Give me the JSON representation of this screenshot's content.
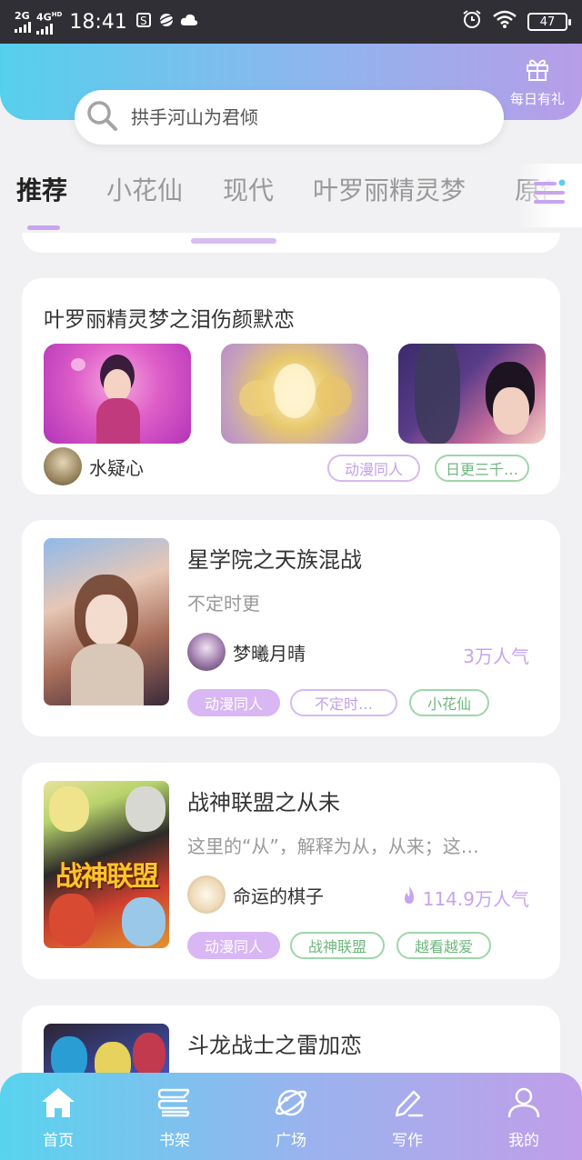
{
  "status_bar": {
    "net1": "2G",
    "net2": "4G",
    "net2_sup": "HD",
    "time": "18:41",
    "battery": "47"
  },
  "header": {
    "gift_label": "每日有礼",
    "search_placeholder": "拱手河山为君倾"
  },
  "tabs": [
    "推荐",
    "小花仙",
    "现代",
    "叶罗丽精灵梦",
    "原创"
  ],
  "collection": {
    "title": "叶罗丽精灵梦之泪伤颜默恋",
    "author": "水疑心",
    "tags": [
      "动漫同人",
      "日更三千…"
    ]
  },
  "books": [
    {
      "title": "星学院之天族混战",
      "desc": "不定时更",
      "author": "梦曦月晴",
      "popularity": "3万人气",
      "hot": false,
      "tags": [
        "动漫同人",
        "不定时…",
        "小花仙"
      ]
    },
    {
      "title": "战神联盟之从未",
      "desc": "这里的“从”，解释为从，从来；这…",
      "author": "命运的棋子",
      "popularity": "114.9万人气",
      "hot": true,
      "cover_text": "战神联盟",
      "tags": [
        "动漫同人",
        "战神联盟",
        "越看越爱"
      ]
    },
    {
      "title": "斗龙战士之雷加恋"
    }
  ],
  "bottom_nav": [
    "首页",
    "书架",
    "广场",
    "写作",
    "我的"
  ],
  "colors": {
    "accent_purple": "#c8a3ef",
    "tag_green": "#6fb77e",
    "gradient_start": "#55d0ec",
    "gradient_end": "#b79de8"
  }
}
